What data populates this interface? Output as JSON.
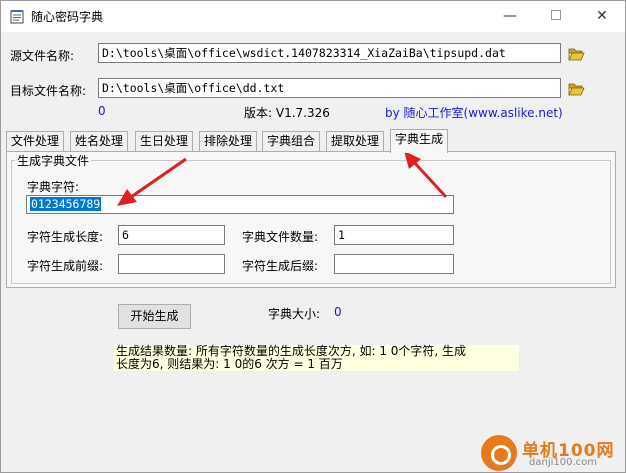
{
  "window": {
    "title": "随心密码字典",
    "controls": {
      "minimize": "—",
      "close": "✕"
    }
  },
  "source": {
    "label": "源文件名称:",
    "value": "D:\\tools\\桌面\\office\\wsdict.1407823314_XiaZaiBa\\tipsupd.dat"
  },
  "target": {
    "label": "目标文件名称:",
    "value": "D:\\tools\\桌面\\office\\dd.txt"
  },
  "info": {
    "count": "0",
    "version": "版本: V1.7.326",
    "by": "by 随心工作室(www.aslike.net)"
  },
  "tabs": [
    "文件处理",
    "姓名处理",
    "生日处理",
    "排除处理",
    "字典组合",
    "提取处理",
    "字典生成"
  ],
  "active_tab": "字典生成",
  "generate": {
    "group_title": "生成字典文件",
    "chars_label": "字典字符:",
    "chars_value": "0123456789",
    "length_label": "字符生成长度:",
    "length_value": "6",
    "file_count_label": "字典文件数量:",
    "file_count_value": "1",
    "prefix_label": "字符生成前缀:",
    "prefix_value": "",
    "suffix_label": "字符生成后缀:",
    "suffix_value": "",
    "start_button": "开始生成",
    "size_label": "字典大小:",
    "size_value": "0",
    "note_line1": "生成结果数量: 所有字符数量的生成长度次方, 如: 1 0个字符, 生成",
    "note_line2": "长度为6, 则结果为: 1 0的6 次方 = 1 百万"
  },
  "watermark": {
    "cn": "单机100网",
    "url": "danji100.com"
  },
  "colors": {
    "accent_blue": "#1a1ad4",
    "arrow_red": "#e02020",
    "selection": "#0078d7",
    "note_bg": "#ffffe1"
  }
}
